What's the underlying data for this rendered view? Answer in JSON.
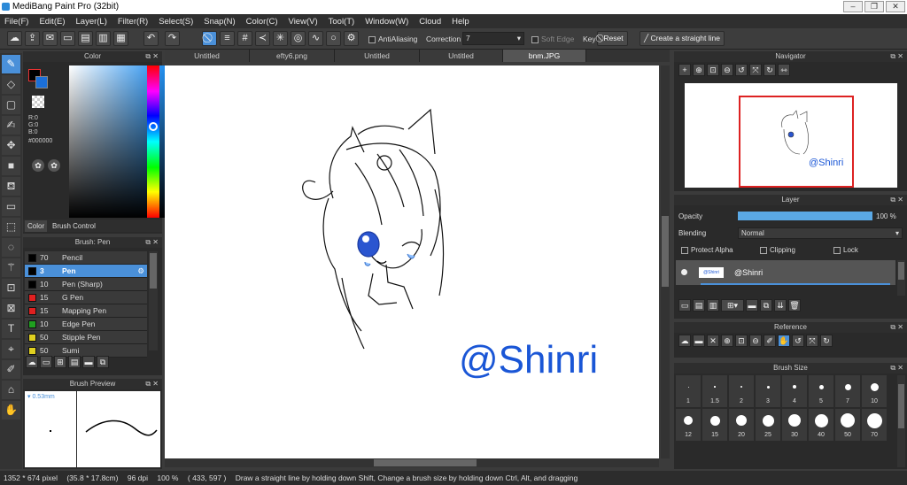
{
  "window": {
    "title": "MediBang Paint Pro (32bit)"
  },
  "menu": [
    "File(F)",
    "Edit(E)",
    "Layer(L)",
    "Filter(R)",
    "Select(S)",
    "Snap(N)",
    "Color(C)",
    "View(V)",
    "Tool(T)",
    "Window(W)",
    "Cloud",
    "Help"
  ],
  "toolbar": {
    "antialiasing_label": "AntiAliasing",
    "correction_label": "Correction",
    "correction_value": "7",
    "soft_edge_label": "Soft Edge",
    "key_label": "Key",
    "reset_label": "Reset",
    "straight_line_label": "Create a straight line"
  },
  "color_panel": {
    "title": "Color",
    "r": "R:0",
    "g": "G:0",
    "b": "B:0",
    "hex": "#000000",
    "tab_color": "Color",
    "tab_brush_control": "Brush Control",
    "primary_color": "#000000",
    "secondary_color": "#1b6fd8"
  },
  "brush_panel": {
    "title": "Brush: Pen",
    "brushes": [
      {
        "size": "70",
        "name": "Pencil",
        "color": "#000000"
      },
      {
        "size": "3",
        "name": "Pen",
        "color": "#000000",
        "selected": true
      },
      {
        "size": "10",
        "name": "Pen (Sharp)",
        "color": "#000000"
      },
      {
        "size": "15",
        "name": "G Pen",
        "color": "#e02020"
      },
      {
        "size": "15",
        "name": "Mapping Pen",
        "color": "#e02020"
      },
      {
        "size": "10",
        "name": "Edge Pen",
        "color": "#20a020"
      },
      {
        "size": "50",
        "name": "Stipple Pen",
        "color": "#e0d020"
      },
      {
        "size": "50",
        "name": "Sumi",
        "color": "#e0d020"
      }
    ]
  },
  "brush_preview": {
    "title": "Brush Preview",
    "size": "0.53mm"
  },
  "tabs": [
    "Untitled",
    "efty6.png",
    "Untitled",
    "Untitled",
    "bnm.JPG"
  ],
  "canvas": {
    "watermark": "@Shinri",
    "watermark_color": "#1a56d6"
  },
  "navigator": {
    "title": "Navigator",
    "thumb_text": "@Shinri"
  },
  "layer_panel": {
    "title": "Layer",
    "opacity_label": "Opacity",
    "opacity_value": "100 %",
    "opacity_fraction": 1.0,
    "blending_label": "Blending",
    "blending_value": "Normal",
    "protect_alpha": "Protect Alpha",
    "clipping": "Clipping",
    "lock": "Lock",
    "layers": [
      {
        "name": "@Shinri"
      }
    ]
  },
  "reference": {
    "title": "Reference"
  },
  "brush_size": {
    "title": "Brush Size",
    "sizes_row1": [
      "1",
      "1.5",
      "2",
      "3",
      "4",
      "5",
      "7",
      "10"
    ],
    "sizes_row2": [
      "12",
      "15",
      "20",
      "25",
      "30",
      "40",
      "50",
      "70"
    ]
  },
  "status": {
    "dimensions": "1352 * 674 pixel",
    "physical": "(35.8 * 17.8cm)",
    "dpi": "96 dpi",
    "zoom": "100 %",
    "coords": "( 433, 597 )",
    "hint": "Draw a straight line by holding down Shift, Change a brush size by holding down Ctrl, Alt, and dragging"
  }
}
